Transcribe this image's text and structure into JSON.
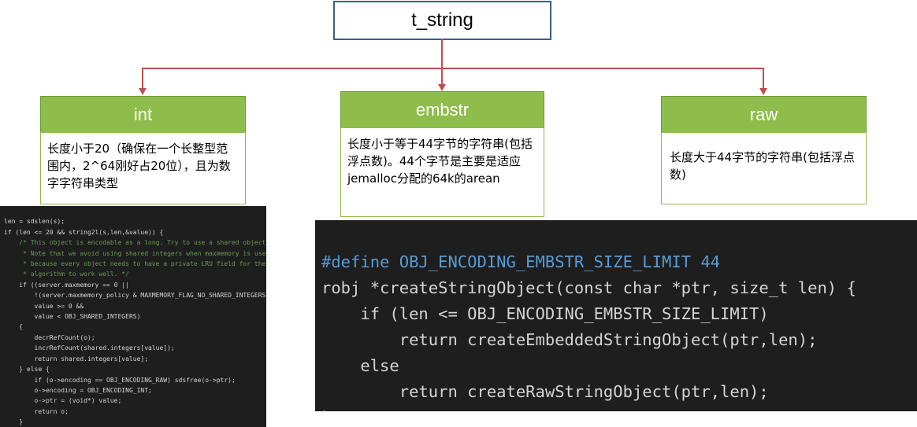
{
  "root": {
    "label": "t_string"
  },
  "nodes": [
    {
      "title": "int",
      "description": "长度小于20（确保在一个长整型范围内，2^64刚好占20位），且为数字字符串类型"
    },
    {
      "title": "embstr",
      "description": "长度小于等于44字节的字符串(包括浮点数)。44个字节是主要是适应jemalloc分配的64k的arean"
    },
    {
      "title": "raw",
      "description": "长度大于44字节的字符串(包括浮点数)"
    }
  ],
  "code_int": [
    "len = sdslen(s);",
    "if (len <= 20 && string2l(s,len,&value)) {",
    "    /* This object is encodable as a long. Try to use a shared object.",
    "     * Note that we avoid using shared integers when maxmemory is used",
    "     * because every object needs to have a private LRU field for the LRU",
    "     * algorithm to work well. */",
    "    if ((server.maxmemory == 0 ||",
    "        !(server.maxmemory_policy & MAXMEMORY_FLAG_NO_SHARED_INTEGERS)) &&",
    "        value >= 0 &&",
    "        value < OBJ_SHARED_INTEGERS)",
    "    {",
    "        decrRefCount(o);",
    "        incrRefCount(shared.integers[value]);",
    "        return shared.integers[value];",
    "    } else {",
    "        if (o->encoding == OBJ_ENCODING_RAW) sdsfree(o->ptr);",
    "        o->encoding = OBJ_ENCODING_INT;",
    "        o->ptr = (void*) value;",
    "        return o;",
    "    }",
    "}"
  ],
  "code_embstr": [
    "#define OBJ_ENCODING_EMBSTR_SIZE_LIMIT 44",
    "robj *createStringObject(const char *ptr, size_t len) {",
    "    if (len <= OBJ_ENCODING_EMBSTR_SIZE_LIMIT)",
    "        return createEmbeddedStringObject(ptr,len);",
    "    else",
    "        return createRawStringObject(ptr,len);",
    "}"
  ]
}
